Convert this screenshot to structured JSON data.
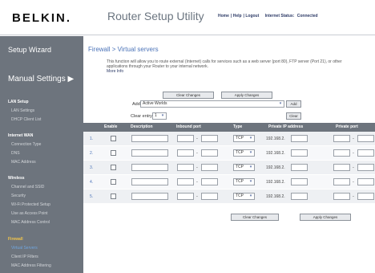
{
  "brand": {
    "logo": "BELKIN."
  },
  "header": {
    "title": "Router Setup Utility",
    "links": [
      "Home",
      "Help",
      "Logout"
    ],
    "status_label": "Internet Status:",
    "status_value": "Connected"
  },
  "sidebar": {
    "wizard": "Setup Wizard",
    "manual": "Manual Settings ▶",
    "sections": [
      {
        "title": "LAN Setup",
        "items": [
          "LAN Settings",
          "DHCP Client List"
        ]
      },
      {
        "title": "Internet WAN",
        "items": [
          "Connection Type",
          "DNS",
          "MAC Address"
        ]
      },
      {
        "title": "Wireless",
        "items": [
          "Channel and SSID",
          "Security",
          "Wi-Fi Protected Setup",
          "Use as Access Point",
          "MAC Address Control"
        ]
      },
      {
        "title": "Firewall",
        "items": [
          "Virtual Servers",
          "Client IP Filters",
          "MAC Address Filtering"
        ]
      }
    ]
  },
  "page": {
    "breadcrumb": "Firewall > Virtual servers",
    "description": "This function will allow you to route external (Internet) calls for services such as a web server (port 80), FTP server (Port 21), or other applications through your Router to your internal network.",
    "more_info": "More Info",
    "clear_changes": "Clear Changes",
    "apply_changes": "Apply Changes",
    "add_label": "Add",
    "add_select": "Active Worlds",
    "add_button": "Add",
    "clear_entry_label": "Clear entry",
    "clear_entry_value": "1",
    "clear_button": "Clear"
  },
  "table": {
    "headers": [
      "Enable",
      "Description",
      "Inbound port",
      "Type",
      "Private IP address",
      "Private port"
    ],
    "rows": [
      {
        "num": "1.",
        "type": "TCP",
        "ip_prefix": "192.168.2."
      },
      {
        "num": "2.",
        "type": "TCP",
        "ip_prefix": "192.168.2."
      },
      {
        "num": "3.",
        "type": "TCP",
        "ip_prefix": "192.168.2."
      },
      {
        "num": "4.",
        "type": "TCP",
        "ip_prefix": "192.168.2."
      },
      {
        "num": "5.",
        "type": "TCP",
        "ip_prefix": "192.168.2."
      }
    ],
    "dash": "-",
    "chevron": "▾"
  }
}
